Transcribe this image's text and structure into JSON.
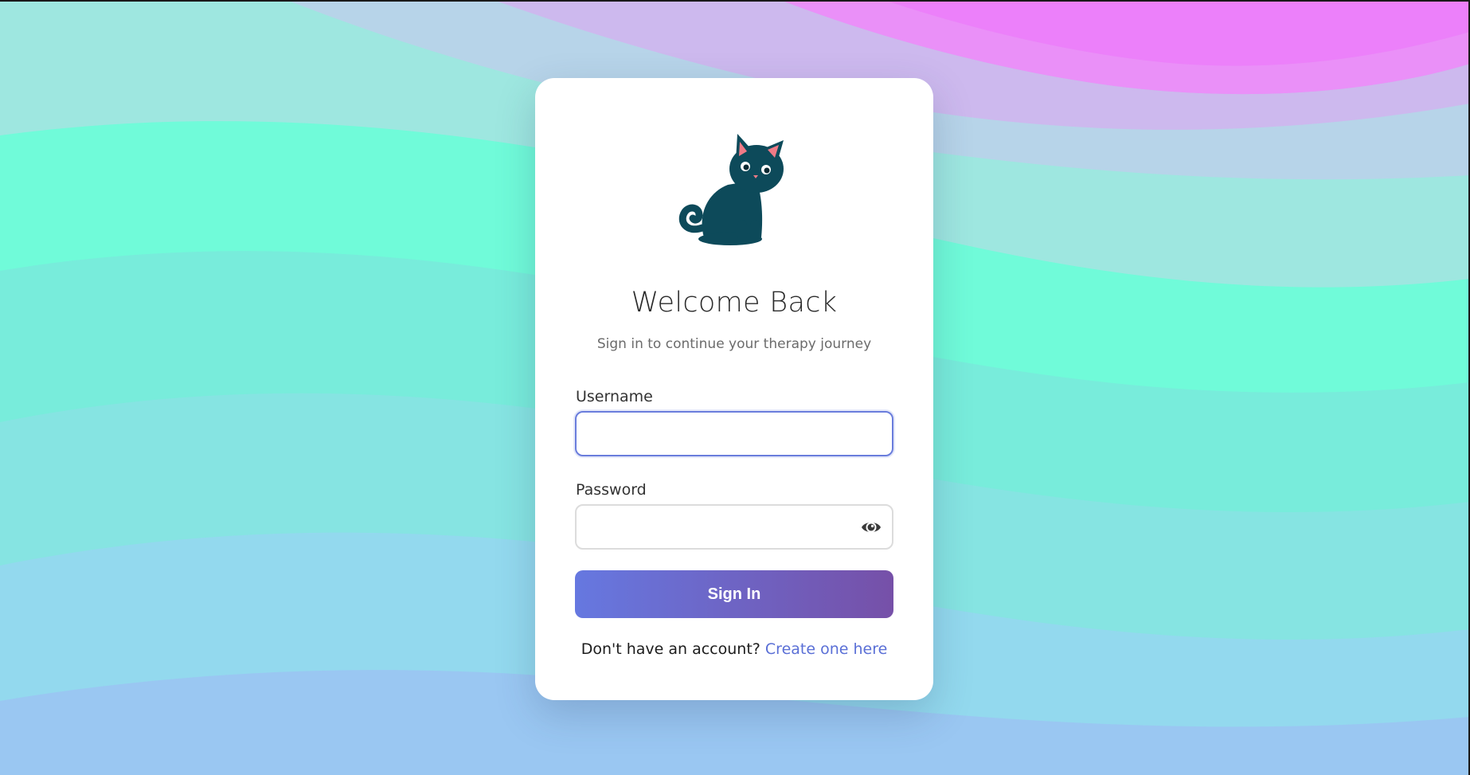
{
  "login": {
    "title": "Welcome Back",
    "subtitle": "Sign in to continue your therapy journey",
    "username_label": "Username",
    "username_value": "",
    "password_label": "Password",
    "password_value": "",
    "signin_label": "Sign In",
    "signup_prompt": "Don't have an account?",
    "signup_link": "Create one here"
  },
  "icons": {
    "logo": "cat-icon",
    "password_toggle": "eye-icon"
  },
  "colors": {
    "accent": "#6a7ddc",
    "button_gradient_start": "#6678e0",
    "button_gradient_end": "#7650a8",
    "link": "#5a6fd6",
    "cat": "#0d4a5a",
    "card_background": "#ffffff"
  }
}
